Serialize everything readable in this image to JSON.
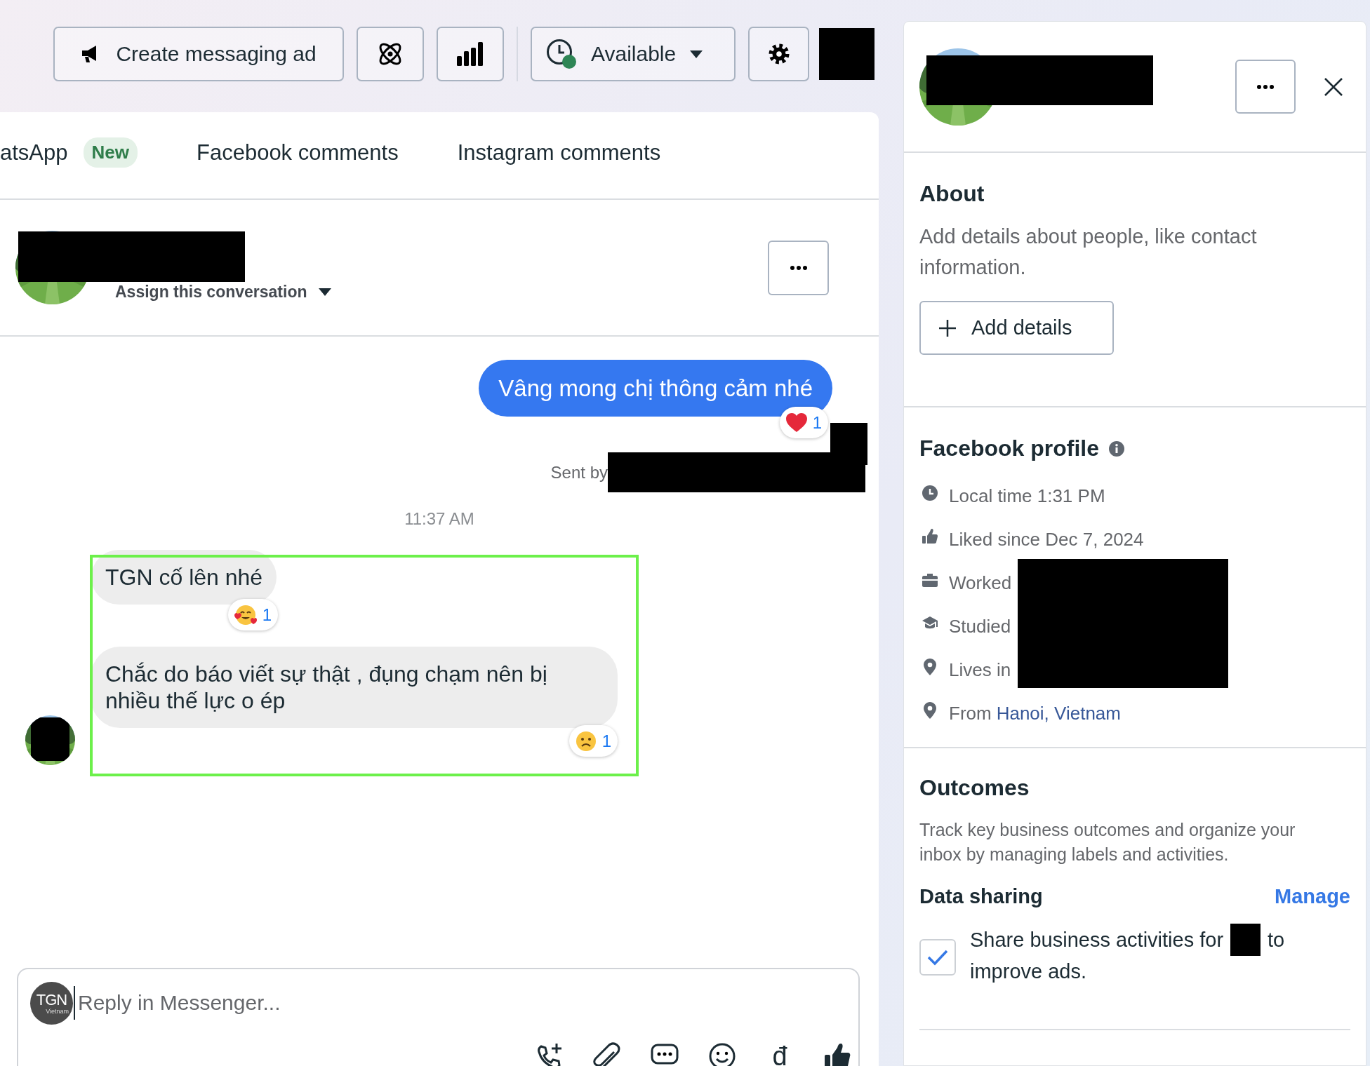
{
  "toolbar": {
    "buttons": [
      {
        "kind": "ad",
        "label": "Create messaging ad"
      },
      {
        "kind": "atom"
      },
      {
        "kind": "insights"
      },
      {
        "kind": "status",
        "label": "Available",
        "online": true
      },
      {
        "kind": "settings"
      }
    ]
  },
  "tabs": [
    {
      "label": "atsApp",
      "badge": "New",
      "selected": false
    },
    {
      "label": "Facebook comments",
      "selected": false
    },
    {
      "label": "Instagram comments",
      "selected": false
    }
  ],
  "conversation": {
    "assign": "Assign this conversation"
  },
  "outgoing": {
    "text": "Vâng mong chị thông cảm nhé",
    "reaction": {
      "kind": "heart",
      "count": "1"
    },
    "sent_by": "Sent by"
  },
  "timestamp": "11:37 AM",
  "incoming": {
    "highlighted": true,
    "messages": [
      {
        "text": "TGN cố lên nhé",
        "reaction": {
          "kind": "smiling-hearts",
          "count": "1"
        }
      },
      {
        "text": "Chắc do báo viết sự thật , đụng chạm nên bị nhiều thế lực o ép",
        "reaction": {
          "kind": "frown",
          "count": "1"
        }
      }
    ]
  },
  "composer": {
    "avatar": "TGN",
    "avatar_caption": "Vietnam",
    "placeholder": "Reply in Messenger...",
    "tools": [
      {
        "kind": "call"
      },
      {
        "kind": "attach"
      },
      {
        "kind": "saved-reply"
      },
      {
        "kind": "emoji"
      },
      {
        "kind": "payment",
        "glyph": "đ"
      },
      {
        "kind": "like"
      }
    ]
  },
  "profile": {
    "about": {
      "title": "About",
      "description": "Add details about people, like contact information.",
      "button": "Add details"
    },
    "facebook_profile": {
      "title": "Facebook profile",
      "rows": [
        {
          "kind": "clock",
          "text": "Local time 1:31 PM"
        },
        {
          "kind": "like",
          "text": "Liked since Dec 7, 2024"
        },
        {
          "kind": "work",
          "text": "Worked"
        },
        {
          "kind": "school",
          "text": "Studied"
        },
        {
          "kind": "pin",
          "text": "Lives in"
        },
        {
          "kind": "pin",
          "text": "From",
          "link": "Hanoi, Vietnam"
        }
      ]
    },
    "outcomes": {
      "title": "Outcomes",
      "description": "Track key business outcomes and organize your inbox by managing labels and activities.",
      "data_sharing": {
        "title": "Data sharing",
        "action": "Manage",
        "checked": true,
        "text_before": "Share business activities for",
        "text_after": "to",
        "text_wrap": "improve ads."
      }
    }
  }
}
